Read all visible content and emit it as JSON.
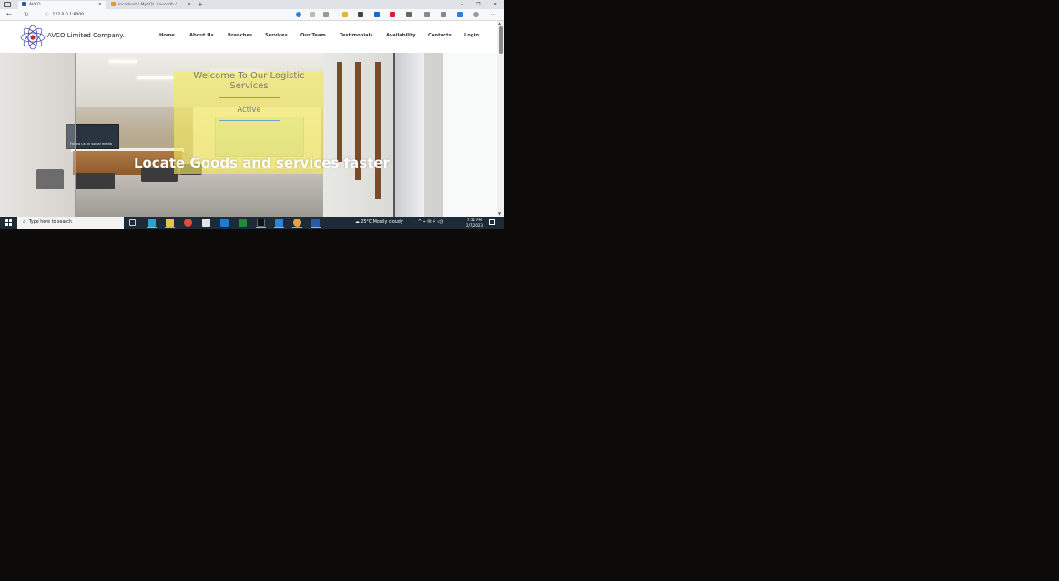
{
  "browser": {
    "tabs": [
      {
        "title": "AVCO",
        "active": true
      },
      {
        "title": "localhost / MySQL / avcodb / ",
        "active": false
      }
    ],
    "new_tab": "+",
    "tab_close": "✕",
    "window_controls": {
      "minimize": "–",
      "restore": "❐",
      "close": "✕"
    },
    "nav": {
      "back": "←",
      "reload": "↻"
    },
    "url": "127.0.0.1:8000",
    "url_icon": "ⓘ",
    "menu": "···"
  },
  "site": {
    "brand": "AVCO Limited Company.",
    "nav": [
      "Home",
      "About Us",
      "Branches",
      "Services",
      "Our Team",
      "Testimonials",
      "Availability",
      "Contacts",
      "Login"
    ],
    "hero": {
      "welcome_title": "Welcome To Our Logistic Services",
      "status": "Active",
      "tagline": "Locate Goods and services faster",
      "tv_caption": "Follow us on social media"
    }
  },
  "taskbar": {
    "search_placeholder": "Type here to search",
    "weather": "25°C  Mostly cloudy",
    "time": "7:52 PM",
    "date": "2/7/2023",
    "tray": "^ ⌁ ✉ ⚡ ◁)"
  },
  "colors": {
    "welcome_overlay": "#f6ec5a",
    "taskbar": "#1d2a37",
    "accent_line": "#6fa6c9"
  }
}
